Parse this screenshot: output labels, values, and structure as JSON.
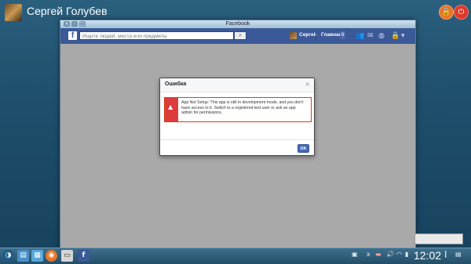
{
  "desktop": {
    "user_name": "Сергей Голубев"
  },
  "window": {
    "title": "Facebook",
    "controls": [
      "×",
      "–",
      "□"
    ]
  },
  "facebook": {
    "search_placeholder": "Ищите людей, места или предметы",
    "profile_name": "Сергей",
    "home_label": "Главная",
    "home_count": "6"
  },
  "dialog": {
    "title": "Ошибка",
    "close": "×",
    "message": "App Not Setup: This app is still in development mode, and you don't have access to it. Switch to a registered test user or ask an app admin for permissions.",
    "ok_label": "OK"
  },
  "taskbar": {
    "clock": "12:02"
  }
}
